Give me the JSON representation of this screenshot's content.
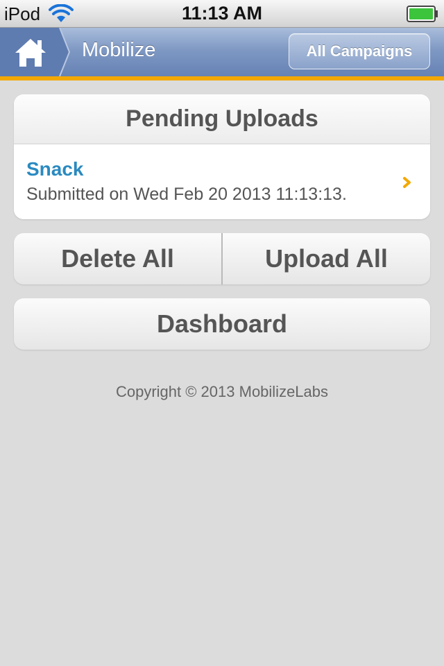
{
  "status_bar": {
    "carrier": "iPod",
    "time": "11:13 AM",
    "wifi_icon": "wifi-icon",
    "battery_icon": "battery-full-icon"
  },
  "nav": {
    "home_icon": "home-icon",
    "title": "Mobilize",
    "campaigns_button": "All Campaigns",
    "accent_color": "#f3a800",
    "bar_color": "#6682b4"
  },
  "pending": {
    "header": "Pending Uploads",
    "items": [
      {
        "title": "Snack",
        "subtitle": "Submitted on Wed Feb 20 2013 11:13:13.",
        "icon": "chevron-right-icon"
      }
    ]
  },
  "actions": {
    "delete_all": "Delete All",
    "upload_all": "Upload All",
    "dashboard": "Dashboard"
  },
  "footer": {
    "copyright": "Copyright © 2013 MobilizeLabs"
  },
  "colors": {
    "background": "#dcdcdc",
    "link": "#2a8ac0",
    "button_text": "#555555"
  }
}
